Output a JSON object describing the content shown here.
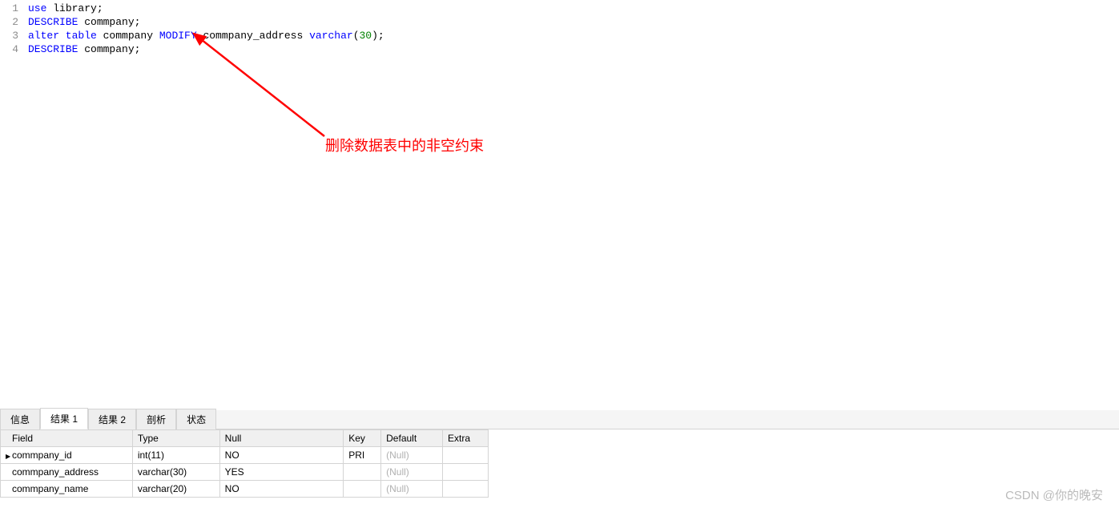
{
  "code": {
    "lines": [
      {
        "num": "1",
        "tokens": [
          {
            "t": "use ",
            "c": "kw"
          },
          {
            "t": "library",
            "c": "ident"
          },
          {
            "t": ";",
            "c": "punct"
          }
        ]
      },
      {
        "num": "2",
        "tokens": [
          {
            "t": "DESCRIBE ",
            "c": "kw"
          },
          {
            "t": "commpany",
            "c": "ident"
          },
          {
            "t": ";",
            "c": "punct"
          }
        ]
      },
      {
        "num": "3",
        "tokens": [
          {
            "t": "alter table ",
            "c": "kw"
          },
          {
            "t": "commpany ",
            "c": "ident"
          },
          {
            "t": "MODIFY ",
            "c": "kw"
          },
          {
            "t": "commpany_address ",
            "c": "ident"
          },
          {
            "t": "varchar",
            "c": "type"
          },
          {
            "t": "(",
            "c": "punct"
          },
          {
            "t": "30",
            "c": "num"
          },
          {
            "t": ")",
            "c": "punct"
          },
          {
            "t": ";",
            "c": "punct"
          }
        ]
      },
      {
        "num": "4",
        "tokens": [
          {
            "t": "DESCRIBE ",
            "c": "kw"
          },
          {
            "t": "commpany",
            "c": "ident"
          },
          {
            "t": ";",
            "c": "punct"
          }
        ]
      }
    ]
  },
  "annotation": {
    "text": "删除数据表中的非空约束"
  },
  "tabs": {
    "items": [
      "信息",
      "结果 1",
      "结果 2",
      "剖析",
      "状态"
    ],
    "active_index": 1
  },
  "result": {
    "headers": [
      "Field",
      "Type",
      "Null",
      "Key",
      "Default",
      "Extra"
    ],
    "rows": [
      {
        "marker": true,
        "Field": "commpany_id",
        "Type": "int(11)",
        "Null": "NO",
        "Key": "PRI",
        "Default": "(Null)",
        "Extra": ""
      },
      {
        "marker": false,
        "Field": "commpany_address",
        "Type": "varchar(30)",
        "Null": "YES",
        "Key": "",
        "Default": "(Null)",
        "Extra": ""
      },
      {
        "marker": false,
        "Field": "commpany_name",
        "Type": "varchar(20)",
        "Null": "NO",
        "Key": "",
        "Default": "(Null)",
        "Extra": ""
      }
    ]
  },
  "watermark": "CSDN @你的晚安"
}
